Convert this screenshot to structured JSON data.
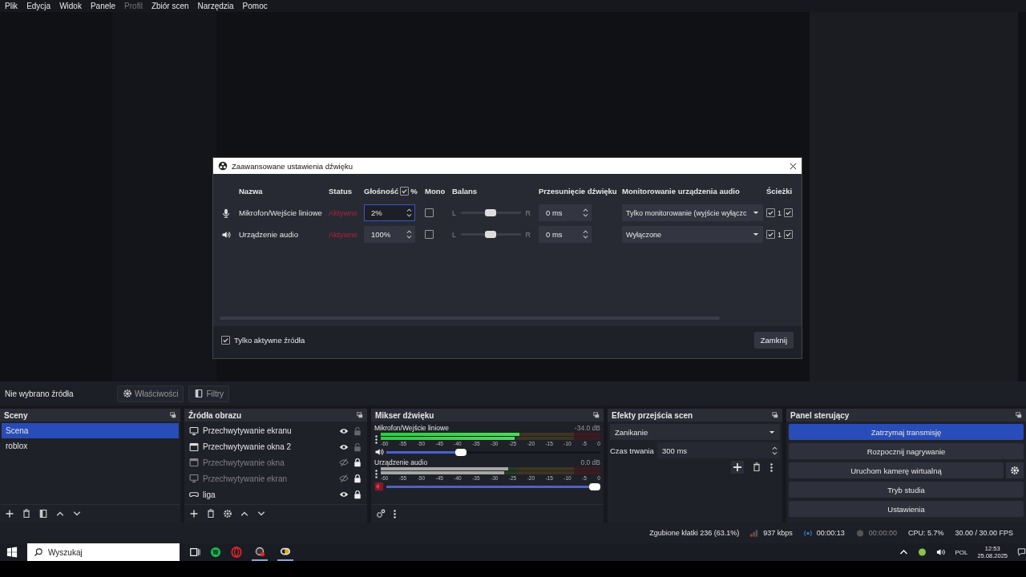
{
  "menu": [
    {
      "label": "Plik",
      "disabled": false
    },
    {
      "label": "Edycja",
      "disabled": false
    },
    {
      "label": "Widok",
      "disabled": false
    },
    {
      "label": "Panele",
      "disabled": false
    },
    {
      "label": "Profil",
      "disabled": true
    },
    {
      "label": "Zbiór scen",
      "disabled": false
    },
    {
      "label": "Narzędzia",
      "disabled": false
    },
    {
      "label": "Pomoc",
      "disabled": false
    }
  ],
  "dialog": {
    "title": "Zaawansowane ustawienia dźwięku",
    "columns": {
      "name": "Nazwa",
      "status": "Status",
      "volume": "Głośność",
      "volume_percent": {
        "label": "%",
        "checked": true
      },
      "mono": "Mono",
      "balance": "Balans",
      "sync": "Przesunięcie dźwięku",
      "monitoring": "Monitorowanie urządzenia audio",
      "tracks": "Ścieżki"
    },
    "rows": [
      {
        "kind": "mic",
        "name": "Mikrofon/Wejście liniowe",
        "status": "Aktywne",
        "volume": "2%",
        "focused": true,
        "mono": false,
        "balance_left": "L",
        "balance_right": "R",
        "balance": {
          "level": 0.5
        },
        "sync": "0 ms",
        "monitoring": "Tylko monitorowanie (wyjście wyłączc",
        "tracks": [
          {
            "label": "1",
            "checked": true
          },
          {
            "checked": true
          }
        ]
      },
      {
        "kind": "speaker",
        "name": "Urządzenie audio",
        "status": "Aktywne",
        "volume": "100%",
        "focused": false,
        "mono": false,
        "balance_left": "L",
        "balance_right": "R",
        "balance": {
          "level": 0.5
        },
        "sync": "0 ms",
        "monitoring": "Wyłączone",
        "tracks": [
          {
            "label": "1",
            "checked": true
          },
          {
            "checked": true
          }
        ]
      }
    ],
    "only_active": {
      "label": "Tylko aktywne źródła",
      "checked": true
    },
    "close": "Zamknij"
  },
  "source_toolbar": {
    "label": "Nie wybrano źródła",
    "buttons": [
      {
        "kind": "gear",
        "label": "Właściwości"
      },
      {
        "kind": "filter",
        "label": "Filtry"
      }
    ]
  },
  "scenes": {
    "title": "Sceny",
    "items": [
      {
        "label": "Scena",
        "selected": true
      },
      {
        "label": "roblox",
        "selected": false
      }
    ]
  },
  "sources": {
    "title": "Źródła obrazu",
    "items": [
      {
        "kind": "monitor",
        "label": "Przechwytywanie ekranu",
        "visible": true,
        "locked": false
      },
      {
        "kind": "window",
        "label": "Przechwytywanie okna 2",
        "visible": true,
        "locked": false
      },
      {
        "kind": "window",
        "label": "Przechwytywanie okna",
        "visible": false,
        "locked": true
      },
      {
        "kind": "monitor",
        "label": "Przechwytywanie ekran",
        "visible": false,
        "locked": true
      },
      {
        "kind": "gamepad",
        "label": "liga",
        "visible": true,
        "locked": true
      }
    ]
  },
  "mixer": {
    "title": "Mikser dźwięku",
    "channels": [
      {
        "name": "Mikrofon/Wejście liniowe",
        "reading": "-34.0 dB",
        "muted": false,
        "meter": {
          "level": 0.63
        },
        "volume": {
          "level": 0.34
        },
        "scale": [
          "-60",
          "-55",
          "-50",
          "-45",
          "-40",
          "-35",
          "-30",
          "-25",
          "-20",
          "-15",
          "-10",
          "-5",
          "0"
        ]
      },
      {
        "name": "Urządzenie audio",
        "reading": "0.0 dB",
        "muted": true,
        "meter": {
          "level": 0.58
        },
        "volume": {
          "level": 1
        },
        "scale": [
          "-60",
          "-55",
          "-50",
          "-45",
          "-40",
          "-35",
          "-30",
          "-25",
          "-20",
          "-15",
          "-10",
          "-5",
          "0"
        ]
      }
    ]
  },
  "transitions": {
    "title": "Efekty przejścia scen",
    "effect": "Zanikanie",
    "duration_label": "Czas trwania",
    "duration": "300 ms"
  },
  "controls": {
    "title": "Panel sterujący",
    "buttons": [
      {
        "label": "Zatrzymaj transmisję",
        "active": true,
        "settings": false
      },
      {
        "label": "Rozpocznij nagrywanie",
        "active": false,
        "settings": false
      },
      {
        "label": "Uruchom kamerę wirtualną",
        "active": false,
        "settings": true
      },
      {
        "label": "Tryb studia",
        "active": false,
        "settings": false
      },
      {
        "label": "Ustawienia",
        "active": false,
        "settings": false
      }
    ]
  },
  "status_bar": {
    "dropped": "Zgubione klatki 236 (63.1%)",
    "bitrate": "937 kbps",
    "stream_time": "00:00:13",
    "record_time": "00:00:00",
    "cpu": "CPU: 5.7%",
    "fps": "30.00 / 30.00 FPS"
  },
  "taskbar": {
    "search_placeholder": "Wyszukaj",
    "language": "POL",
    "time": "12:53",
    "date": "25.08.2025"
  }
}
